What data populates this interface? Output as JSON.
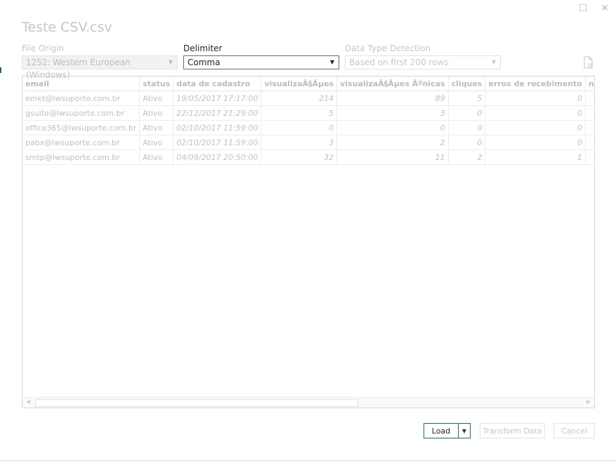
{
  "window": {
    "maximize_glyph": "☐",
    "close_glyph": "✕"
  },
  "dialog": {
    "title": "Teste CSV.csv"
  },
  "file_origin": {
    "label": "File Origin",
    "value": "1252: Western European (Windows)"
  },
  "delimiter": {
    "label": "Delimiter",
    "value": "Comma"
  },
  "data_type_detection": {
    "label": "Data Type Detection",
    "value": "Based on first 200 rows"
  },
  "dropdown_glyph": "▼",
  "preview": {
    "columns": [
      "email",
      "status",
      "data de cadastro",
      "visualizaÃ§Ãµes",
      "visualizaÃ§Ãµes Ãºnicas",
      "cliques",
      "erros de recebimento",
      "nÃºmero"
    ],
    "rows": [
      [
        "emkt@lwsuporte.com.br",
        "Ativo",
        "19/05/2017 17:17:00",
        "214",
        "89",
        "5",
        "0",
        ""
      ],
      [
        "gsuite@lwsuporte.com.br",
        "Ativo",
        "22/12/2017 21:29:00",
        "5",
        "3",
        "0",
        "0",
        ""
      ],
      [
        "office365@lwsuporte.com.br",
        "Ativo",
        "02/10/2017 11:59:00",
        "0",
        "0",
        "0",
        "0",
        ""
      ],
      [
        "pabx@lwsuporte.com.br",
        "Ativo",
        "02/10/2017 11:59:00",
        "3",
        "2",
        "0",
        "0",
        ""
      ],
      [
        "smtp@lwsuporte.com.br",
        "Ativo",
        "04/09/2017 20:50:00",
        "32",
        "11",
        "2",
        "1",
        ""
      ]
    ]
  },
  "buttons": {
    "load": "Load",
    "transform": "Transform Data",
    "cancel": "Cancel"
  },
  "colors": {
    "accent": "#1e6e4e",
    "disabled_text": "#c6c6c6"
  }
}
